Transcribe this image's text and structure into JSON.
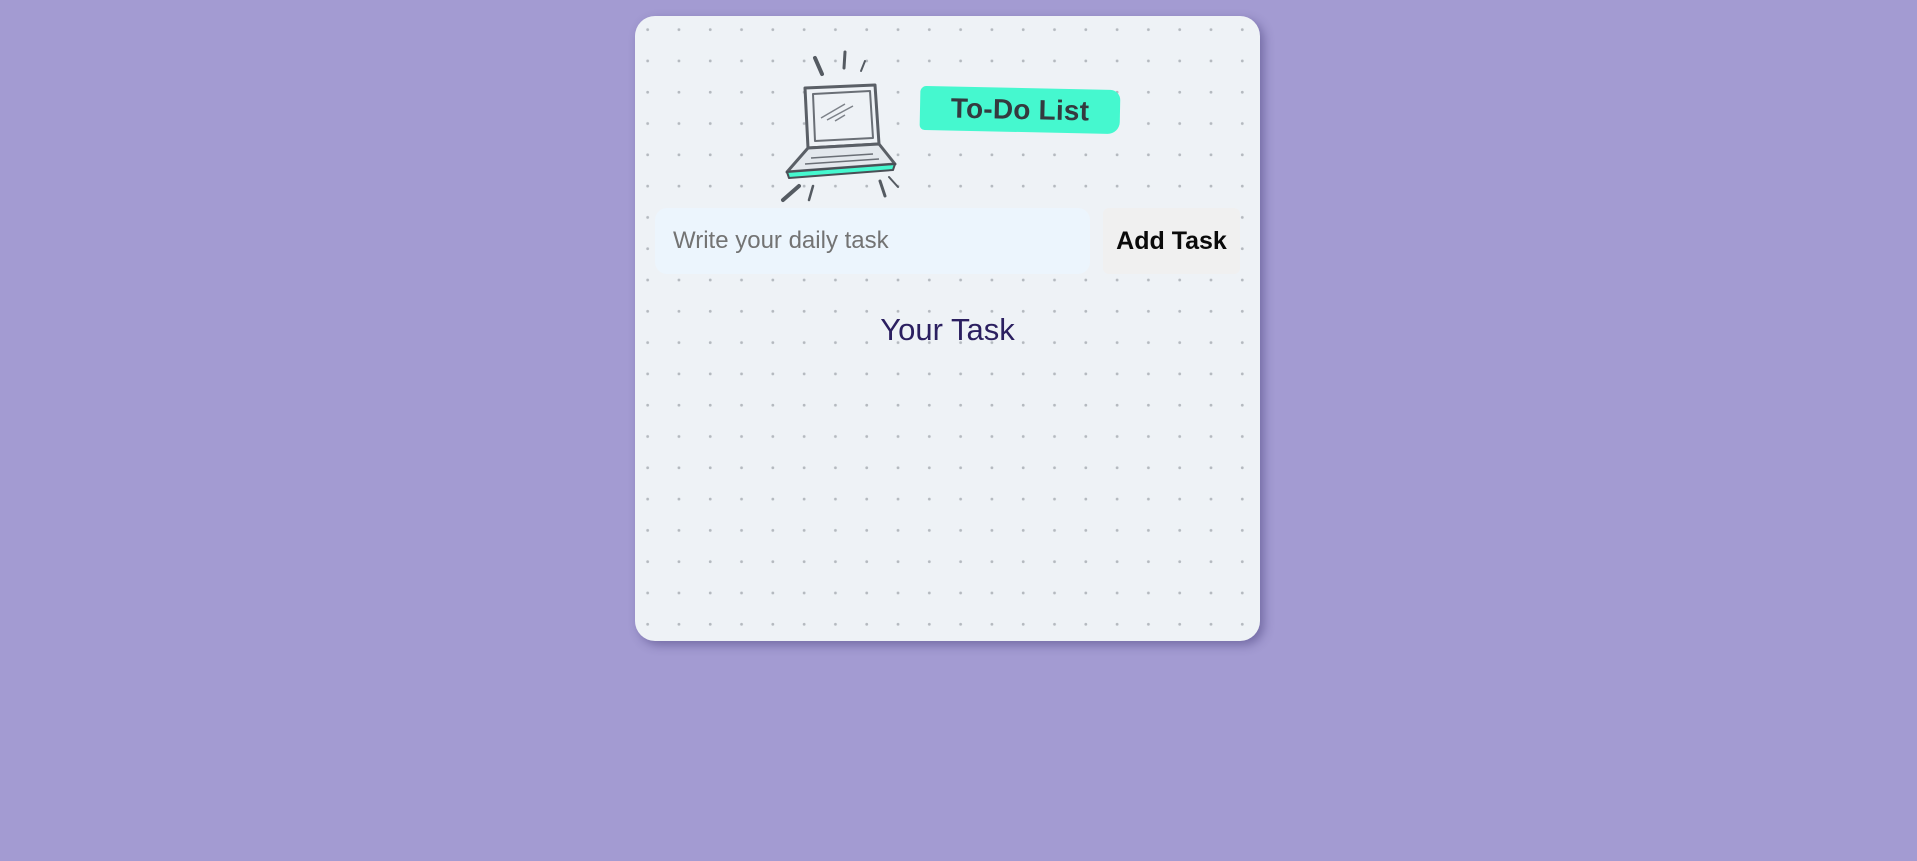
{
  "page": {
    "background_color": "#a39bd2"
  },
  "header": {
    "illustration_icon": "laptop-icon",
    "title": "To-Do List",
    "title_highlight_color": "#45f8cf"
  },
  "task_form": {
    "input_value": "",
    "input_placeholder": "Write your daily task",
    "add_button_label": "Add Task"
  },
  "tasks_section": {
    "heading": "Your Task",
    "heading_color": "#2b1f60",
    "items": []
  }
}
